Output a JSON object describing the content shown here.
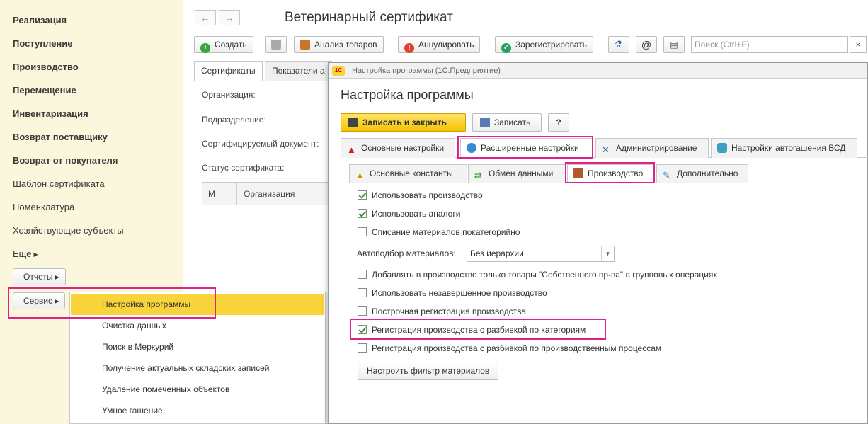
{
  "sidebar": {
    "items": [
      {
        "label": "Реализация",
        "bold": true
      },
      {
        "label": "Поступление",
        "bold": true
      },
      {
        "label": "Производство",
        "bold": true
      },
      {
        "label": "Перемещение",
        "bold": true
      },
      {
        "label": "Инвентаризация",
        "bold": true
      },
      {
        "label": "Возврат поставщику",
        "bold": true
      },
      {
        "label": "Возврат от покупателя",
        "bold": true
      },
      {
        "label": "Шаблон сертификата",
        "bold": false
      },
      {
        "label": "Номенклатура",
        "bold": false
      },
      {
        "label": "Хозяйствующие субъекты",
        "bold": false
      },
      {
        "label": "Еще",
        "bold": false
      }
    ],
    "reports_button": "Отчеты",
    "service_button": "Сервис"
  },
  "service_menu": {
    "items": [
      {
        "label": "Настройка программы",
        "active": true
      },
      {
        "label": "Очистка данных",
        "active": false
      },
      {
        "label": "Поиск в Меркурий",
        "active": false
      },
      {
        "label": "Получение актуальных складских записей",
        "active": false
      },
      {
        "label": "Удаление помеченных объектов",
        "active": false
      },
      {
        "label": "Умное гашение",
        "active": false
      }
    ]
  },
  "document": {
    "nav_back": "←",
    "nav_forward": "→",
    "title": "Ветеринарный сертификат",
    "toolbar": {
      "create": "Создать",
      "analyze": "Анализ товаров",
      "annul": "Аннулировать",
      "register": "Зарегистрировать",
      "at": "@"
    },
    "search_placeholder": "Поиск (Ctrl+F)",
    "search_clear": "×",
    "tabs": [
      "Сертификаты",
      "Показатели а"
    ],
    "fields": {
      "organization": "Организация:",
      "department": "Подразделение:",
      "certified_doc": "Сертифицируемый документ:",
      "status": "Статус сертификата:"
    },
    "table_columns": [
      "М",
      "Организация"
    ]
  },
  "dialog": {
    "window_title": "Настройка программы (1С:Предприятие)",
    "logo_text": "1С",
    "heading": "Настройка программы",
    "buttons": {
      "save_close": "Записать и закрыть",
      "save": "Записать",
      "help": "?"
    },
    "top_tabs": [
      {
        "label": "Основные настройки",
        "icon": "warning-icon",
        "active": false
      },
      {
        "label": "Расширенные настройки",
        "icon": "globe-user-icon",
        "active": true
      },
      {
        "label": "Администрирование",
        "icon": "tools-icon",
        "active": false
      },
      {
        "label": "Настройки автогашения ВСД",
        "icon": "robot-icon",
        "active": false
      }
    ],
    "inner_tabs": [
      {
        "label": "Основные константы",
        "icon": "warning-icon",
        "active": false
      },
      {
        "label": "Обмен данными",
        "icon": "exchange-icon",
        "active": false
      },
      {
        "label": "Производство",
        "icon": "factory-icon",
        "active": true
      },
      {
        "label": "Дополнительно",
        "icon": "wrench-icon",
        "active": false
      }
    ],
    "checkboxes_top": [
      {
        "label": "Использовать производство",
        "checked": true
      },
      {
        "label": "Использовать аналоги",
        "checked": true
      },
      {
        "label": "Списание материалов покатегорийно",
        "checked": false
      }
    ],
    "autoselect": {
      "label": "Автоподбор материалов:",
      "value": "Без иерархии"
    },
    "checkboxes_bottom": [
      {
        "label": "Добавлять в производство только товары  \"Собственного пр-ва\" в групповых операциях",
        "checked": false
      },
      {
        "label": "Использовать незавершенное производство",
        "checked": false
      },
      {
        "label": "Построчная регистрация производства",
        "checked": false
      },
      {
        "label": "Регистрация производства с разбивкой по категориям",
        "checked": true
      },
      {
        "label": "Регистрация производства с разбивкой по производственным процессам",
        "checked": false
      }
    ],
    "filter_button": "Настроить фильтр материалов"
  },
  "colors": {
    "sidebar_bg": "#fbf7dd",
    "active_menu": "#f8d33a",
    "highlight": "#e0218a",
    "check": "#2a9a2a"
  }
}
